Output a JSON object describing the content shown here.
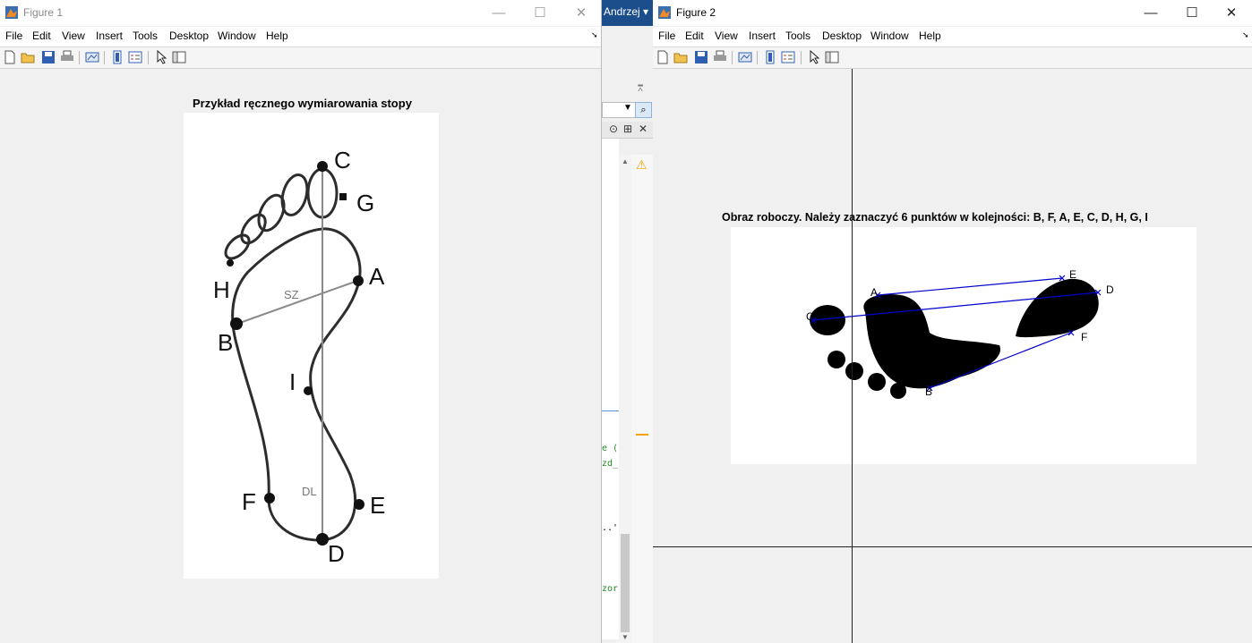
{
  "figure1": {
    "title": "Figure 1",
    "menu": [
      "File",
      "Edit",
      "View",
      "Insert",
      "Tools",
      "Desktop",
      "Window",
      "Help"
    ],
    "axes_title": "Przykład ręcznego wymiarowania stopy",
    "labels": {
      "a": "A",
      "b": "B",
      "c": "C",
      "d": "D",
      "e": "E",
      "f": "F",
      "g": "G",
      "h": "H",
      "i": "I",
      "sz": "SZ",
      "dl": "DL"
    }
  },
  "figure2": {
    "title": "Figure 2",
    "menu": [
      "File",
      "Edit",
      "View",
      "Insert",
      "Tools",
      "Desktop",
      "Window",
      "Help"
    ],
    "axes_title": "Obraz roboczy. Należy zaznaczyć 6 punktów w kolejności: B, F, A, E, C, D, H, G, I",
    "labels": {
      "a": "A",
      "b": "B",
      "c": "C",
      "d": "D",
      "e": "E",
      "f": "F"
    }
  },
  "matlab": {
    "user": "Andrzej",
    "code_fragments": [
      "e (",
      "zd_",
      "..'",
      "zor"
    ]
  },
  "icons": {
    "window_icon": "matlab-icon",
    "minimize": "minimize-icon",
    "maximize": "maximize-icon",
    "close": "close-icon"
  },
  "colors": {
    "marker_line": "#0000cc",
    "badge": "#1a4d8a",
    "warning": "#f7a200"
  }
}
